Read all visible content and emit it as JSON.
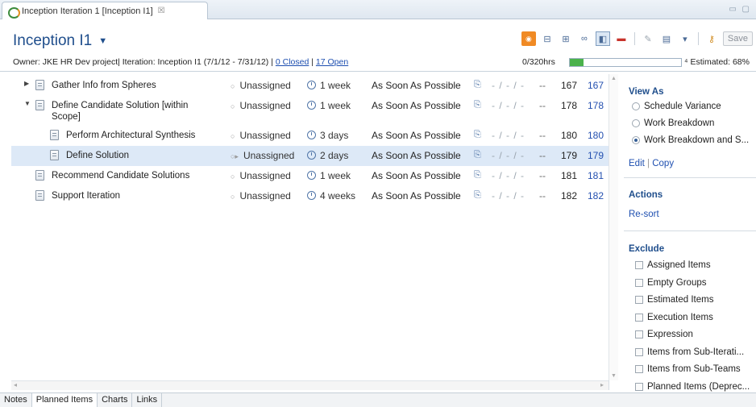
{
  "tab": {
    "title": "Inception Iteration 1 [Inception I1]",
    "close": "☒"
  },
  "header": {
    "title": "Inception I1",
    "owner_prefix": "Owner: JKE HR Dev project| Iteration: Inception I1 (7/1/12 - 7/31/12) |",
    "closed_link": "0 Closed",
    "sep": "|",
    "open_link": "17 Open",
    "hours": "0/320hrs",
    "progress": 0.12,
    "estimated": "Estimated: 68%",
    "save_label": "Save"
  },
  "rows": [
    {
      "name": "Gather Info from Spheres",
      "owner": "Unassigned",
      "duration": "1 week",
      "priority": "As Soon As Possible",
      "dates": "- / - / -",
      "dash": "--",
      "num": "167",
      "link": "167"
    },
    {
      "name": "Define Candidate Solution [within Scope]",
      "owner": "Unassigned",
      "duration": "1 week",
      "priority": "As Soon As Possible",
      "dates": "- / - / -",
      "dash": "--",
      "num": "178",
      "link": "178"
    },
    {
      "name": "Perform Architectural Synthesis",
      "owner": "Unassigned",
      "duration": "3 days",
      "priority": "As Soon As Possible",
      "dates": "- / - / -",
      "dash": "--",
      "num": "180",
      "link": "180"
    },
    {
      "name": "Define Solution",
      "owner": "Unassigned",
      "duration": "2 days",
      "priority": "As Soon As Possible",
      "dates": "- / - / -",
      "dash": "--",
      "num": "179",
      "link": "179"
    },
    {
      "name": "Recommend Candidate Solutions",
      "owner": "Unassigned",
      "duration": "1 week",
      "priority": "As Soon As Possible",
      "dates": "- / - / -",
      "dash": "--",
      "num": "181",
      "link": "181"
    },
    {
      "name": "Support Iteration",
      "owner": "Unassigned",
      "duration": "4 weeks",
      "priority": "As Soon As Possible",
      "dates": "- / - / -",
      "dash": "--",
      "num": "182",
      "link": "182"
    }
  ],
  "panel": {
    "view_as_title": "View As",
    "view_options": [
      "Schedule Variance",
      "Work Breakdown",
      "Work Breakdown and S..."
    ],
    "edit_link": "Edit",
    "copy_link": "Copy",
    "actions_title": "Actions",
    "resort_link": "Re-sort",
    "exclude_title": "Exclude",
    "exclude_items": [
      "Assigned Items",
      "Empty Groups",
      "Estimated Items",
      "Execution Items",
      "Expression",
      "Items from Sub-Iterati...",
      "Items from Sub-Teams",
      "Planned Items (Deprec..."
    ]
  },
  "bottom_tabs": [
    "Notes",
    "Planned Items",
    "Charts",
    "Links"
  ],
  "colors": {
    "title_blue": "#1f4e8c",
    "link_blue": "#1e4fb0",
    "selection": "#dde9f7",
    "progress_green": "#4bb24b",
    "rss_orange": "#f08a24"
  }
}
